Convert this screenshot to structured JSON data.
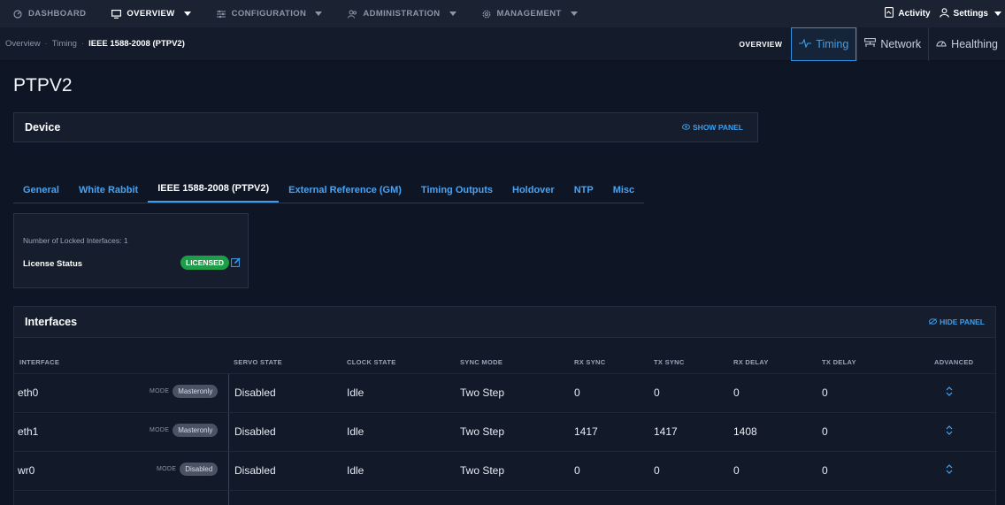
{
  "topnav": {
    "items": [
      {
        "label": "DASHBOARD",
        "icon": "dashboard-icon",
        "active": false,
        "caret": false
      },
      {
        "label": "OVERVIEW",
        "icon": "monitor-icon",
        "active": true,
        "caret": true
      },
      {
        "label": "CONFIGURATION",
        "icon": "sliders-icon",
        "active": false,
        "caret": true
      },
      {
        "label": "ADMINISTRATION",
        "icon": "users-icon",
        "active": false,
        "caret": true
      },
      {
        "label": "MANAGEMENT",
        "icon": "gear-icon",
        "active": false,
        "caret": true
      }
    ],
    "activity": "Activity",
    "settings": "Settings"
  },
  "breadcrumb": {
    "items": [
      "Overview",
      "Timing"
    ],
    "current": "IEEE 1588-2008 (PTPV2)"
  },
  "viewtabs": {
    "label": "OVERVIEW",
    "tabs": [
      {
        "label": "Timing",
        "icon": "pulse-icon",
        "active": true
      },
      {
        "label": "Network",
        "icon": "network-icon",
        "active": false
      },
      {
        "label": "Healthing",
        "icon": "gauge-icon",
        "active": false
      }
    ]
  },
  "page": {
    "title": "PTPV2"
  },
  "device_panel": {
    "title": "Device",
    "show_panel": "SHOW PANEL"
  },
  "tabs": [
    {
      "label": "General",
      "active": false
    },
    {
      "label": "White Rabbit",
      "active": false
    },
    {
      "label": "IEEE 1588-2008 (PTPV2)",
      "active": true
    },
    {
      "label": "External Reference (GM)",
      "active": false
    },
    {
      "label": "Timing Outputs",
      "active": false
    },
    {
      "label": "Holdover",
      "active": false
    },
    {
      "label": "NTP",
      "active": false
    },
    {
      "label": "Misc",
      "active": false
    }
  ],
  "status": {
    "locked_interfaces": "Number of Locked Interfaces: 1",
    "license_label": "License Status",
    "license_value": "LICENSED",
    "license_color": "#1d9d47"
  },
  "interfaces": {
    "title": "Interfaces",
    "hide_panel": "HIDE PANEL",
    "columns": [
      "INTERFACE",
      "SERVO STATE",
      "CLOCK STATE",
      "SYNC MODE",
      "RX SYNC",
      "TX SYNC",
      "RX DELAY",
      "TX DELAY",
      "ADVANCED"
    ],
    "mode_label": "MODE",
    "rows": [
      {
        "name": "eth0",
        "mode": "Masteronly",
        "servo": "Disabled",
        "clock": "Idle",
        "sync_mode": "Two Step",
        "rx_sync": "0",
        "tx_sync": "0",
        "rx_delay": "0",
        "tx_delay": "0"
      },
      {
        "name": "eth1",
        "mode": "Masteronly",
        "servo": "Disabled",
        "clock": "Idle",
        "sync_mode": "Two Step",
        "rx_sync": "1417",
        "tx_sync": "1417",
        "rx_delay": "1408",
        "tx_delay": "0"
      },
      {
        "name": "wr0",
        "mode": "Disabled",
        "servo": "Disabled",
        "clock": "Idle",
        "sync_mode": "Two Step",
        "rx_sync": "0",
        "tx_sync": "0",
        "rx_delay": "0",
        "tx_delay": "0"
      }
    ]
  },
  "colors": {
    "accent": "#3a9ff0",
    "background": "#0e1525",
    "licensed": "#1d9d47"
  }
}
